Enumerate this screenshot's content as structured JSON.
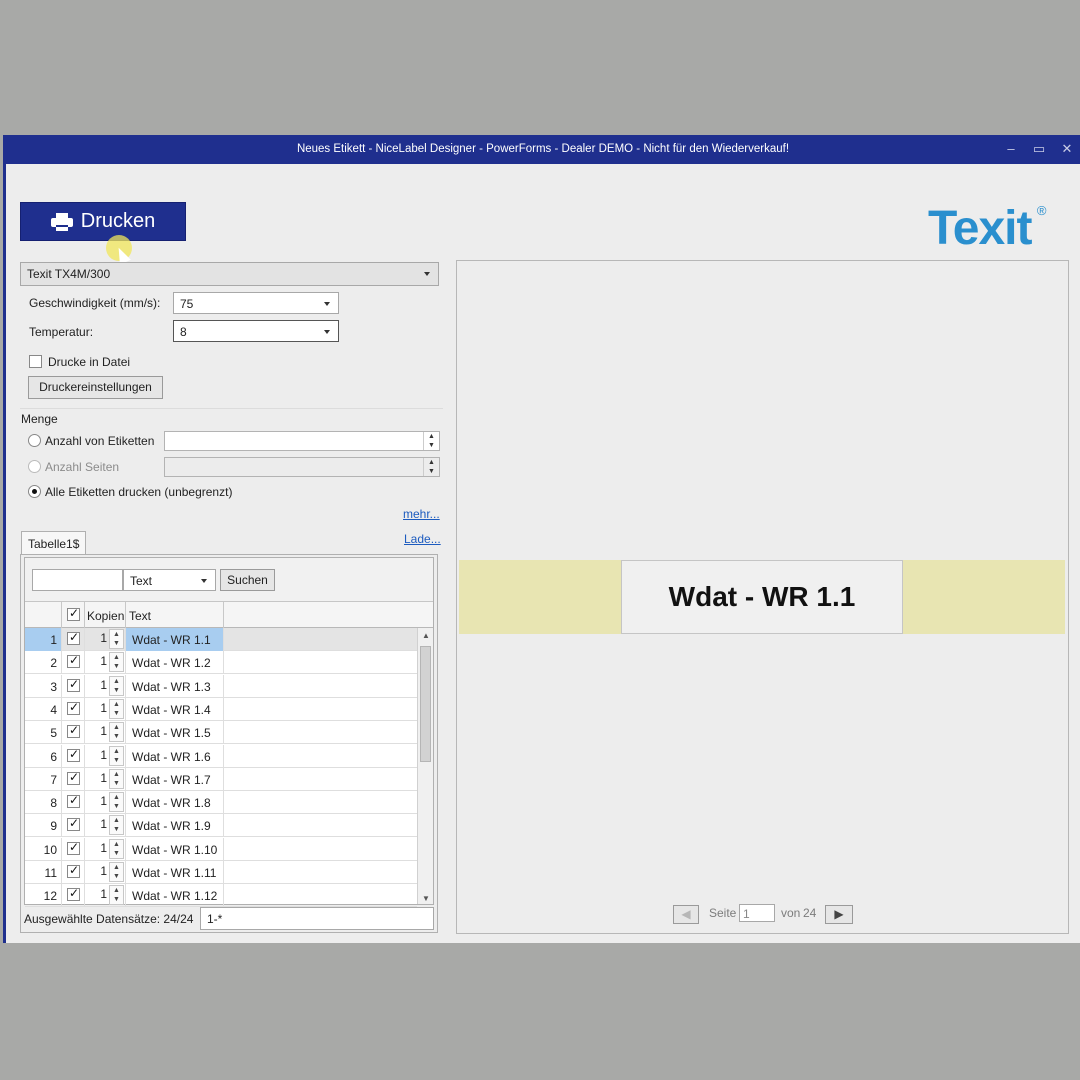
{
  "window": {
    "title": "Neues Etikett - NiceLabel Designer - PowerForms - Dealer DEMO - Nicht für den Wiederverkauf!",
    "controls": [
      "–",
      "▭",
      "✕"
    ]
  },
  "toolbar": {
    "print_label": "Drucken",
    "print_icon": "printer-icon"
  },
  "logo": {
    "text": "Texit",
    "mark": "®",
    "color": "#2a8fce"
  },
  "printer": {
    "selected": "Texit TX4M/300",
    "speed_label": "Geschwindigkeit (mm/s):",
    "speed_value": "75",
    "temp_label": "Temperatur:",
    "temp_value": "8",
    "print_to_file_label": "Drucke in Datei",
    "settings_button": "Druckereinstellungen"
  },
  "quantity": {
    "heading": "Menge",
    "opt_labels": "Anzahl von Etiketten",
    "opt_pages": "Anzahl Seiten",
    "opt_all": "Alle Etiketten drucken (unbegrenzt)",
    "more_link": "mehr..."
  },
  "table": {
    "tab": "Tabelle1$",
    "load_link": "Lade...",
    "search_field": "Text",
    "search_button": "Suchen",
    "col_copies": "Kopien",
    "col_text": "Text",
    "rows": [
      {
        "n": "1",
        "copies": "1",
        "text": "Wdat - WR 1.1"
      },
      {
        "n": "2",
        "copies": "1",
        "text": "Wdat - WR 1.2"
      },
      {
        "n": "3",
        "copies": "1",
        "text": "Wdat - WR 1.3"
      },
      {
        "n": "4",
        "copies": "1",
        "text": "Wdat - WR 1.4"
      },
      {
        "n": "5",
        "copies": "1",
        "text": "Wdat - WR 1.5"
      },
      {
        "n": "6",
        "copies": "1",
        "text": "Wdat - WR 1.6"
      },
      {
        "n": "7",
        "copies": "1",
        "text": "Wdat - WR 1.7"
      },
      {
        "n": "8",
        "copies": "1",
        "text": "Wdat - WR 1.8"
      },
      {
        "n": "9",
        "copies": "1",
        "text": "Wdat - WR 1.9"
      },
      {
        "n": "10",
        "copies": "1",
        "text": "Wdat - WR 1.10"
      },
      {
        "n": "11",
        "copies": "1",
        "text": "Wdat - WR 1.11"
      },
      {
        "n": "12",
        "copies": "1",
        "text": "Wdat - WR 1.12"
      }
    ],
    "selected_label": "Ausgewählte Datensätze: 24/24",
    "selected_range": "1-*"
  },
  "preview": {
    "label_text": "Wdat - WR 1.1",
    "page_label": "Seite",
    "page_value": "1",
    "of_label": "von",
    "page_total": "24"
  }
}
